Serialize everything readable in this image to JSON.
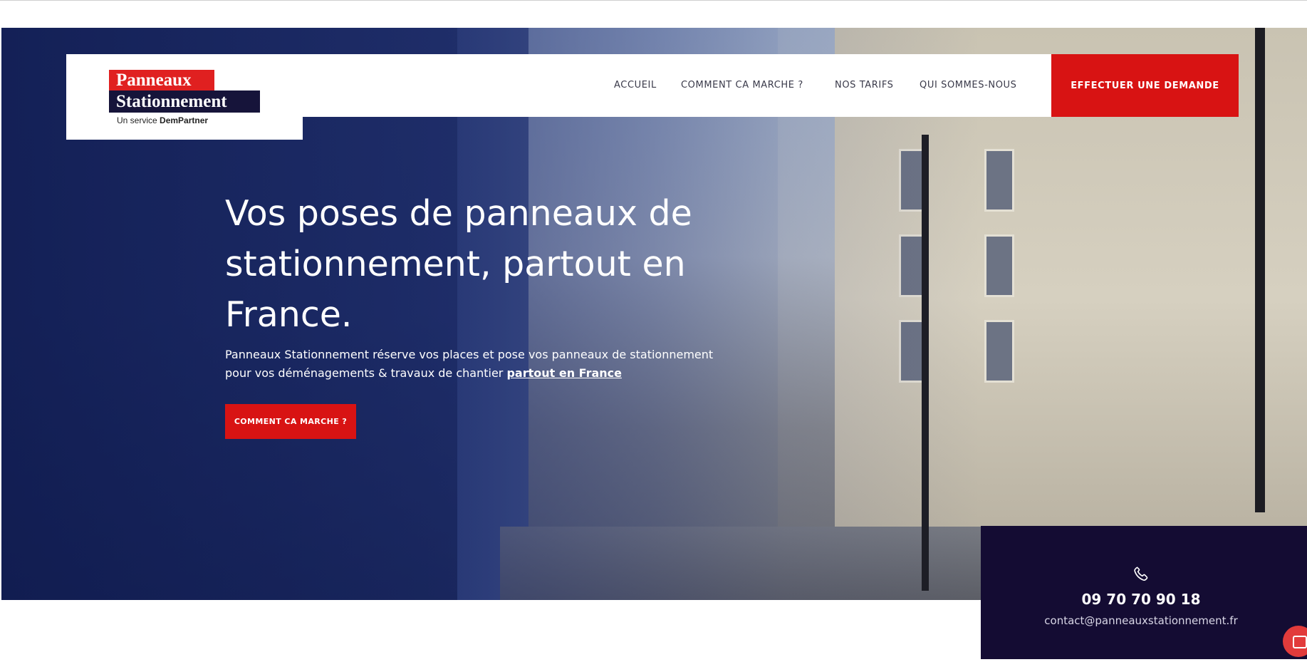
{
  "logo": {
    "line1": "Panneaux",
    "line2": "Stationnement",
    "sub_prefix": "Un service",
    "sub_brand": "DemPartner"
  },
  "nav": {
    "items": [
      {
        "label": "ACCUEIL"
      },
      {
        "label": "COMMENT CA MARCHE ?"
      },
      {
        "label": "NOS TARIFS"
      },
      {
        "label": "QUI SOMMES-NOUS"
      }
    ],
    "cta_label": "EFFECTUER UNE DEMANDE"
  },
  "hero": {
    "title": "Vos poses de panneaux de stationnement, partout en France.",
    "desc": "Panneaux Stationnement réserve vos places et pose vos panneaux de stationnement pour vos déménagements & travaux de chantier",
    "desc_link": "partout en France",
    "cta_label": "COMMENT CA MARCHE ?"
  },
  "contact": {
    "phone": "09 70 70 90 18",
    "email": "contact@panneauxstationnement.fr",
    "icon": "phone-icon"
  },
  "colors": {
    "brand_red": "#d81313",
    "brand_dark": "#140c33"
  }
}
